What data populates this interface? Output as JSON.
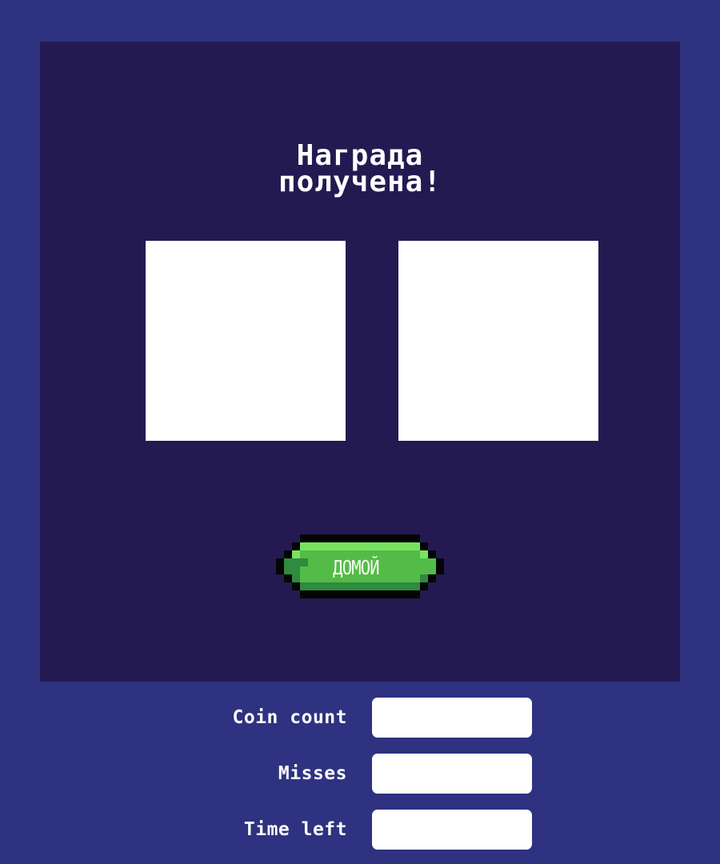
{
  "game": {
    "title_line1": "Награда",
    "title_line2": "получена!",
    "home_button_label": "ДОМОЙ",
    "colors": {
      "background": "#2e3280",
      "panel": "#241a52",
      "slot": "#ffffff",
      "button_green": "#54bb48",
      "button_highlight": "#78e35f",
      "button_shadow": "#2f8b3d",
      "button_outline": "#050505"
    }
  },
  "stats": [
    {
      "label": "Coin count",
      "value": ""
    },
    {
      "label": "Misses",
      "value": ""
    },
    {
      "label": "Time left",
      "value": ""
    }
  ]
}
